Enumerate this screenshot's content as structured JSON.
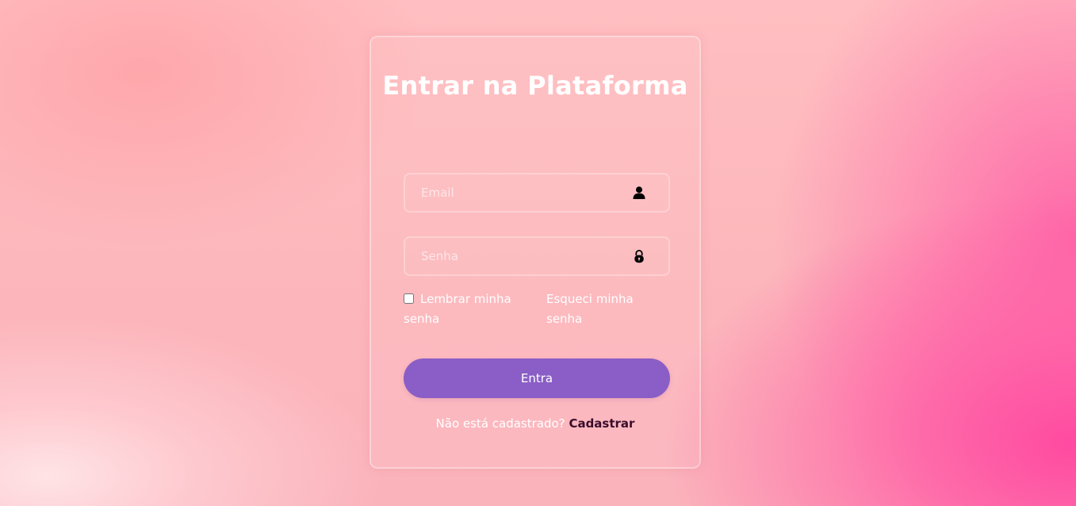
{
  "login": {
    "title": "Entrar na Plataforma",
    "email_placeholder": "Email",
    "email_icon": "user-icon",
    "password_placeholder": "Senha",
    "password_icon": "lock-icon",
    "remember_label": "Lembrar minha senha",
    "remember_checked": false,
    "forgot_label": "Esqueci minha senha",
    "submit_label": "Entra",
    "signup_prompt": "Não está cadastrado?",
    "signup_link": "Cadastrar"
  },
  "colors": {
    "button": "#8a5ec6",
    "signup_link": "#3a0d2c",
    "accent_pink": "#ff5aa5"
  }
}
